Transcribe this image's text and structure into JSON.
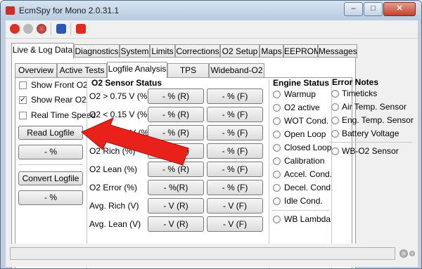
{
  "window": {
    "title": "EcmSpy for Mono 2.0.31.1",
    "min_label": "–",
    "max_label": "□",
    "close_label": "✕"
  },
  "toolbar": {
    "icons": [
      "record-icon",
      "settings-icon",
      "stop-icon",
      "info-icon",
      "power-icon"
    ]
  },
  "main_tabs": [
    "Live & Log Data",
    "Diagnostics",
    "System",
    "Limits",
    "Corrections",
    "O2 Setup",
    "Maps",
    "EEPROM",
    "Messages"
  ],
  "sub_tabs": [
    "Overview",
    "Active Tests",
    "Logfile Analysis",
    "TPS Reset",
    "Wideband-O2"
  ],
  "options": {
    "show_front_o2": "Show Front O2",
    "show_rear_o2": "Show Rear O2",
    "real_time_speed": "Real Time Speed"
  },
  "buttons": {
    "read_logfile": "Read Logfile",
    "read_progress": "- %",
    "convert_logfile": "Convert Logfile",
    "convert_progress": "- %"
  },
  "o2_status": {
    "heading": "O2 Sensor Status",
    "rows": [
      {
        "label": "O2 > 0.75 V (%)",
        "r": "- % (R)",
        "f": "- % (F)"
      },
      {
        "label": "O2 < 0.15 V (%)",
        "r": "- % (R)",
        "f": "- % (F)"
      },
      {
        "label": "Diff > 0.45 V (%)",
        "r": "- % (R)",
        "f": "- % (F)"
      },
      {
        "label": "O2 Rich (%)",
        "r": "- % (R)",
        "f": "- % (F)"
      },
      {
        "label": "O2 Lean (%)",
        "r": "- % (R)",
        "f": "- % (F)"
      },
      {
        "label": "O2 Error (%)",
        "r": "- %(R)",
        "f": "- % (F)"
      },
      {
        "label": "Avg. Rich  (V)",
        "r": "- V (R)",
        "f": "- V (F)"
      },
      {
        "label": "Avg. Lean (V)",
        "r": "- V (R)",
        "f": "- V (F)"
      }
    ]
  },
  "engine_status": {
    "heading": "Engine Status",
    "items": [
      "Warmup",
      "O2 active",
      "WOT Cond.",
      "Open Loop",
      "Closed Loop",
      "Calibration",
      "Accel. Cond.",
      "Decel. Cond.",
      "Idle Cond."
    ],
    "extra": "WB Lambda"
  },
  "error_notes": {
    "heading": "Error Notes",
    "items": [
      "Timeticks",
      "Air Temp. Sensor",
      "Eng. Temp. Sensor",
      "Battery Voltage"
    ],
    "extra": "WB-O2 Sensor"
  },
  "colors": {
    "accent": "#d93127",
    "arrow": "#e8221b"
  }
}
